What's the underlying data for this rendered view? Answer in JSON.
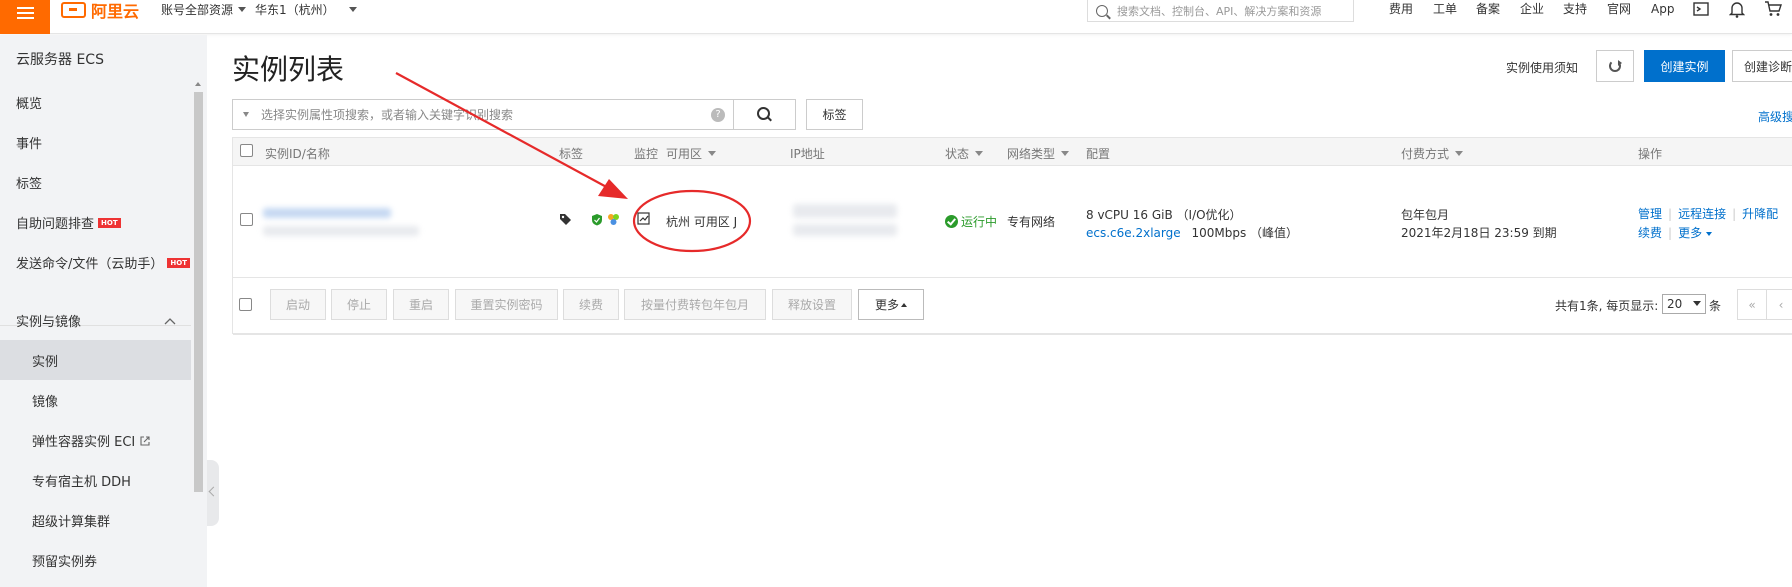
{
  "topbar": {
    "logo_text": "阿里云",
    "account_scope": "账号全部资源",
    "region": "华东1（杭州）",
    "search_placeholder": "搜索文档、控制台、API、解决方案和资源",
    "links": [
      "费用",
      "工单",
      "备案",
      "企业",
      "支持",
      "官网",
      "App"
    ],
    "brand_color": "#ff6a00"
  },
  "sidebar": {
    "title": "云服务器 ECS",
    "items": [
      {
        "label": "概览"
      },
      {
        "label": "事件"
      },
      {
        "label": "标签"
      },
      {
        "label": "自助问题排查",
        "badge": "HOT"
      },
      {
        "label": "发送命令/文件（云助手）",
        "badge": "HOT"
      }
    ],
    "group": {
      "label": "实例与镜像",
      "items": [
        {
          "label": "实例"
        },
        {
          "label": "镜像"
        },
        {
          "label": "弹性容器实例 ECI"
        },
        {
          "label": "专有宿主机 DDH"
        },
        {
          "label": "超级计算集群"
        },
        {
          "label": "预留实例券"
        }
      ]
    }
  },
  "page": {
    "title": "实例列表",
    "notice_link": "实例使用须知",
    "create_button": "创建实例",
    "create_diag_button": "创建诊断",
    "search_placeholder": "选择实例属性项搜索，或者输入关键字识别搜索",
    "help": "?",
    "tag_button": "标签",
    "advanced_search": "高级搜索",
    "accent_color": "#0070cc"
  },
  "table": {
    "columns": [
      "实例ID/名称",
      "标签",
      "监控",
      "可用区",
      "IP地址",
      "状态",
      "网络类型",
      "配置",
      "付费方式",
      "操作"
    ],
    "rows": [
      {
        "zone": "杭州 可用区 J",
        "status": "运行中",
        "network": "专有网络",
        "config_line1": "8 vCPU 16 GiB （I/O优化）",
        "config_type": "ecs.c6e.2xlarge",
        "config_bandwidth": "100Mbps （峰值）",
        "billing": "包年包月",
        "expire": "2021年2月18日 23:59 到期",
        "ops": [
          "管理",
          "远程连接",
          "升降配",
          "续费",
          "更多"
        ]
      }
    ],
    "batch_buttons": [
      "启动",
      "停止",
      "重启",
      "重置实例密码",
      "续费",
      "按量付费转包年包月",
      "释放设置"
    ],
    "more_button": "更多",
    "pager_total": "共有1条, 每页显示:",
    "page_size": "20",
    "pager_unit": "条",
    "first_page": "«",
    "prev_page": "‹"
  }
}
